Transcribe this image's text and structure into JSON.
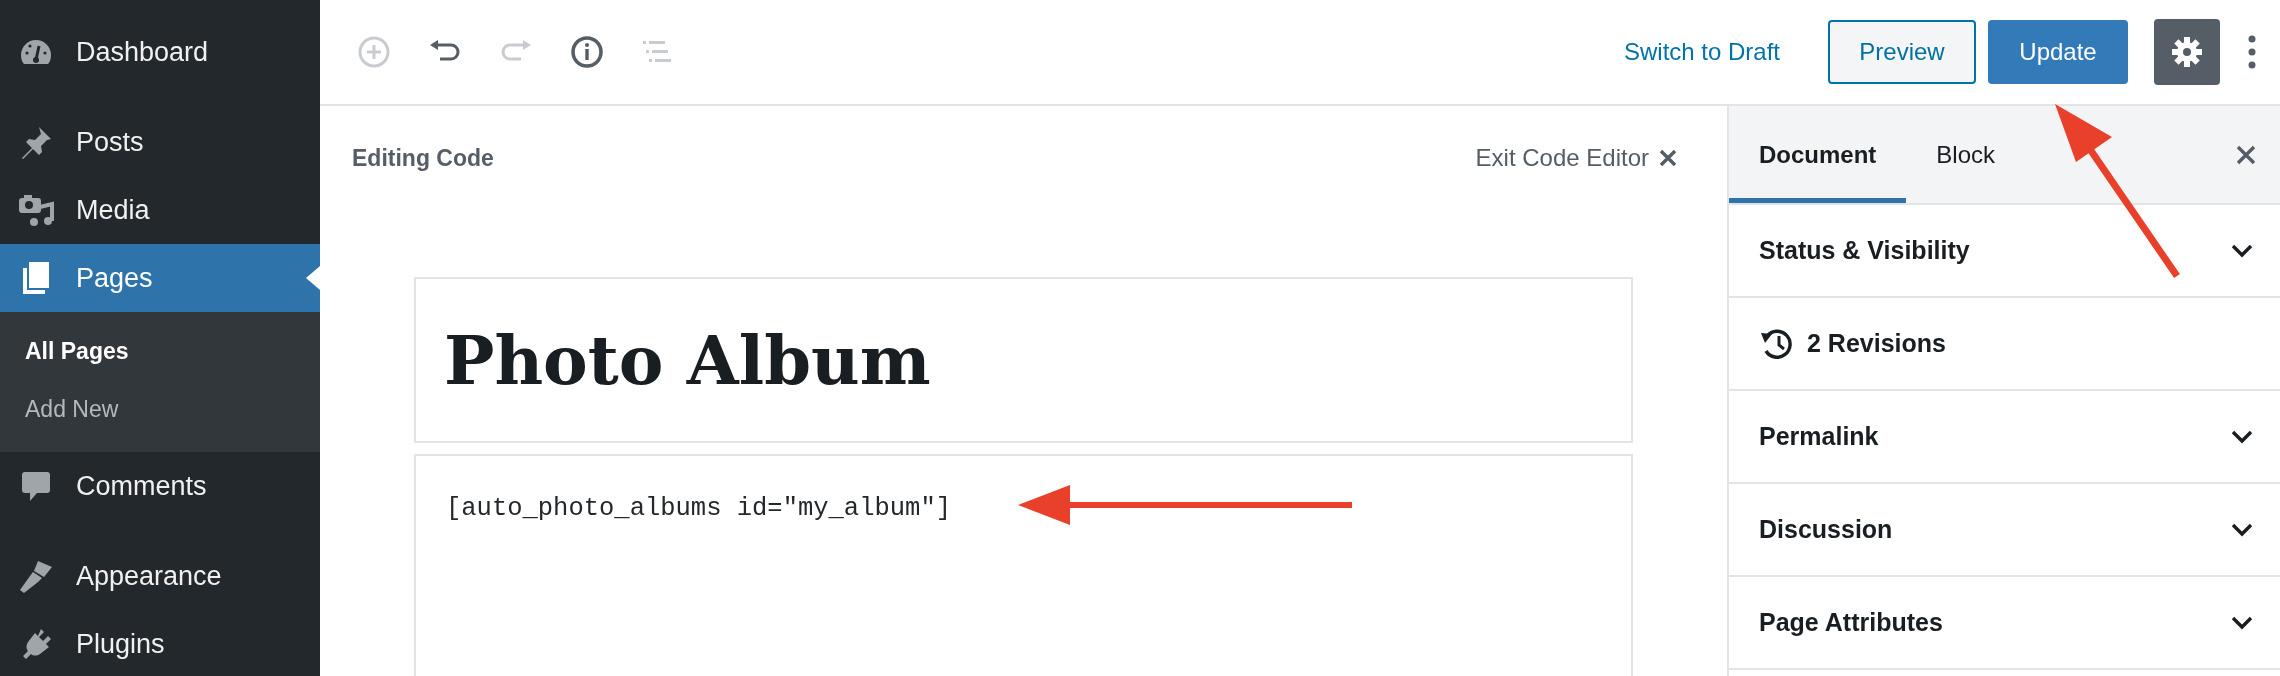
{
  "sidebar": {
    "groups": [
      [
        {
          "label": "Dashboard",
          "selected": false
        }
      ],
      [
        {
          "label": "Posts",
          "selected": false
        },
        {
          "label": "Media",
          "selected": false
        },
        {
          "label": "Pages",
          "selected": true,
          "children": [
            {
              "label": "All Pages",
              "selected": true
            },
            {
              "label": "Add New",
              "selected": false
            }
          ]
        },
        {
          "label": "Comments",
          "selected": false
        }
      ],
      [
        {
          "label": "Appearance",
          "selected": false
        },
        {
          "label": "Plugins",
          "selected": false
        }
      ]
    ]
  },
  "toolbar": {
    "tools": [
      {
        "kind": "add",
        "disabled": true
      },
      {
        "kind": "undo",
        "disabled": false
      },
      {
        "kind": "redo",
        "disabled": true
      },
      {
        "kind": "info",
        "disabled": false
      },
      {
        "kind": "outline",
        "disabled": true
      }
    ],
    "switch_link": "Switch to Draft",
    "preview_button": "Preview",
    "update_button": "Update",
    "settings_button": {
      "selected": true
    }
  },
  "editor": {
    "heading": "Editing Code",
    "exit_button": "Exit Code Editor",
    "title": "Photo Album",
    "code": "[auto_photo_albums id=\"my_album\"]"
  },
  "settings_panel": {
    "tabs": [
      {
        "label": "Document",
        "selected": true
      },
      {
        "label": "Block",
        "selected": false
      }
    ],
    "sections": [
      {
        "kind": "panel",
        "label": "Status & Visibility",
        "expanded": false
      },
      {
        "kind": "revisions",
        "label": "2 Revisions"
      },
      {
        "kind": "panel",
        "label": "Permalink",
        "expanded": false
      },
      {
        "kind": "panel",
        "label": "Discussion",
        "expanded": false
      },
      {
        "kind": "panel",
        "label": "Page Attributes",
        "expanded": false
      }
    ]
  }
}
